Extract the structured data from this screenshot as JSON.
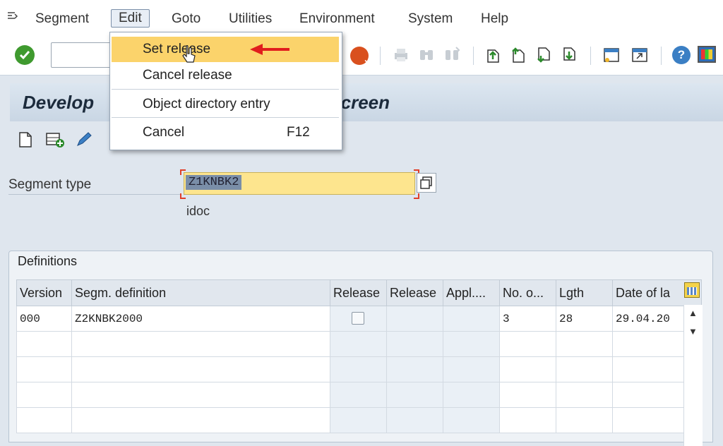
{
  "menubar": {
    "items": [
      {
        "label": "Segment"
      },
      {
        "label": "Edit"
      },
      {
        "label": "Goto"
      },
      {
        "label": "Utilities"
      },
      {
        "label": "Environment"
      },
      {
        "label": "System"
      },
      {
        "label": "Help"
      }
    ]
  },
  "dropdown": {
    "items": [
      {
        "label": "Set release",
        "shortcut": "",
        "highlighted": true
      },
      {
        "label": "Cancel release",
        "shortcut": ""
      },
      {
        "label": "Object directory entry",
        "shortcut": ""
      },
      {
        "label": "Cancel",
        "shortcut": "F12"
      }
    ]
  },
  "title": {
    "left": "Develop",
    "right": "screen"
  },
  "form": {
    "segment_type_label": "Segment type",
    "segment_type_value": "Z1KNBK2",
    "description": "idoc"
  },
  "definitions": {
    "title": "Definitions",
    "columns": [
      "Version",
      "Segm. definition",
      "Release",
      "Release",
      "Appl....",
      "No. o...",
      "Lgth",
      "Date of la"
    ],
    "rows": [
      [
        "000",
        "Z2KNBK2000",
        "",
        "",
        "",
        "3",
        "28",
        "29.04.20"
      ]
    ]
  },
  "colors": {
    "highlight": "#fbd36b",
    "input_bg": "#fde58e",
    "ok_green": "#3f9a2f",
    "cancel_orange": "#d9501e",
    "arrow_red": "#e11d1d"
  },
  "icons": [
    "menu-icon",
    "enter-icon",
    "cancel-icon",
    "print-icon",
    "find-icon",
    "find-next-icon",
    "first-page-icon",
    "previous-page-icon",
    "next-page-icon",
    "last-page-icon",
    "create-session-icon",
    "shortcut-icon",
    "help-icon",
    "customize-layout-icon",
    "create-icon",
    "add-row-icon",
    "pencil-icon",
    "value-help-icon",
    "column-settings-icon"
  ]
}
